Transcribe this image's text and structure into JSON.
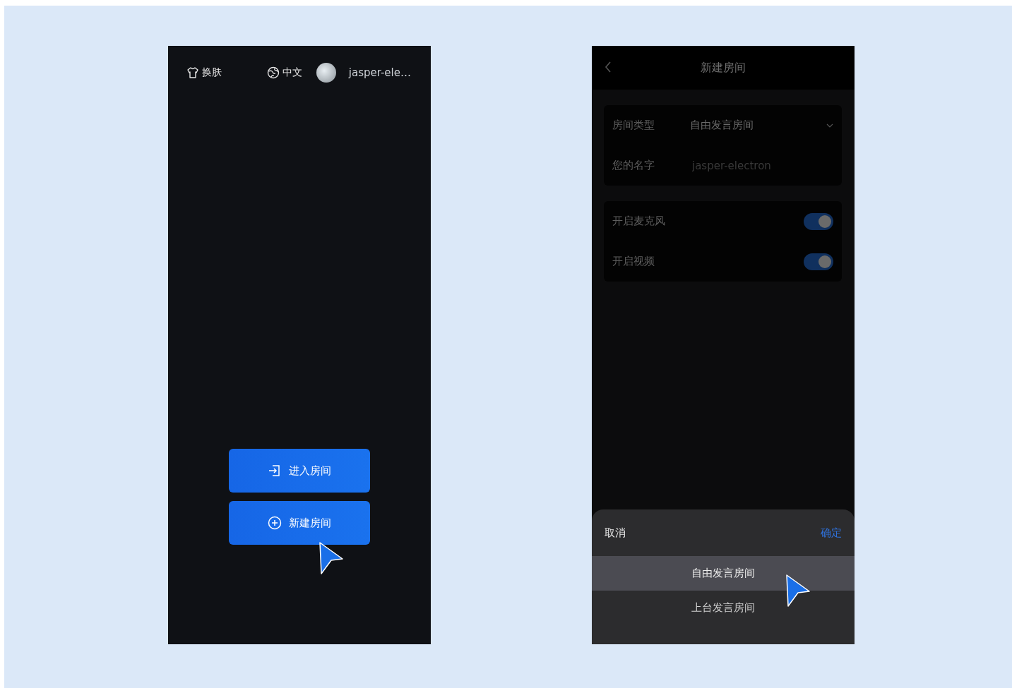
{
  "home_screen": {
    "header": {
      "skin_button": "换肤",
      "language_button": "中文",
      "user_name": "jasper-ele…"
    },
    "buttons": [
      {
        "kind": "enter",
        "label": "进入房间"
      },
      {
        "kind": "create",
        "label": "新建房间"
      }
    ]
  },
  "create_room_screen": {
    "title": "新建房间",
    "form": [
      {
        "kind": "select",
        "label": "房间类型",
        "value": "自由发言房间"
      },
      {
        "kind": "input",
        "label": "您的名字",
        "placeholder": "jasper-electron"
      }
    ],
    "toggles": [
      {
        "label": "开启麦克风",
        "on": true
      },
      {
        "label": "开启视频",
        "on": true
      }
    ],
    "picker": {
      "cancel": "取消",
      "confirm": "确定",
      "options": [
        {
          "label": "自由发言房间",
          "selected": true
        },
        {
          "label": "上台发言房间",
          "selected": false
        }
      ]
    }
  }
}
